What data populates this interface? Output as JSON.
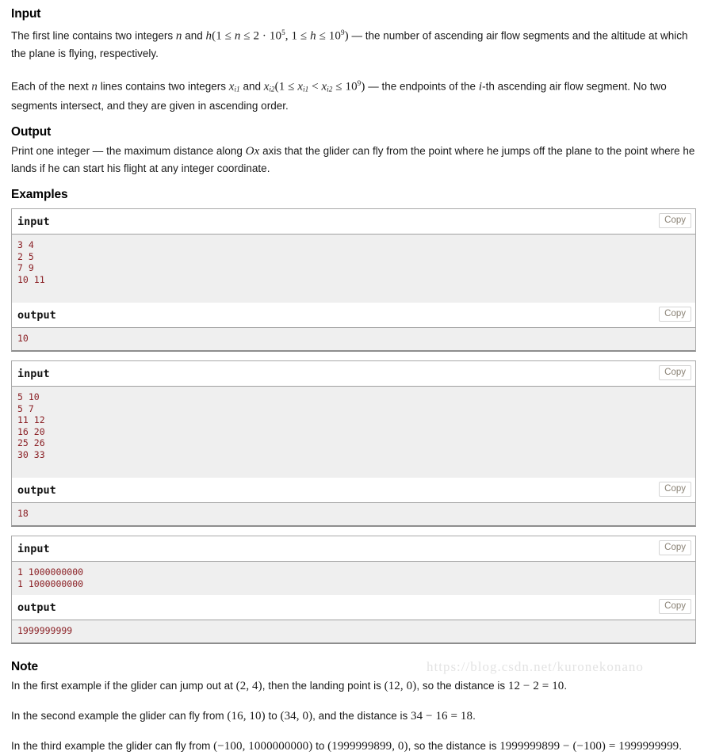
{
  "sections": {
    "input": {
      "heading": "Input",
      "paragraph1": {
        "p1": "The first line contains two integers ",
        "m_n": "n",
        "p2": " and ",
        "m_h": "h",
        "m_cond_open": "(1 ≤ ",
        "m_cond_n": "n",
        "m_cond_mid": " ≤ 2 · 10",
        "m_cond_exp1": "5",
        "m_cond_mid2": ", 1 ≤ ",
        "m_cond_h": "h",
        "m_cond_mid3": " ≤ 10",
        "m_cond_exp2": "9",
        "m_cond_close": ")",
        "p3": " — the number of ascending air flow segments and the altitude at which the plane is flying, respectively."
      },
      "paragraph2": {
        "p1": "Each of the next ",
        "m_n": "n",
        "p2": " lines contains two integers ",
        "m_x1": "x",
        "m_x1sub": "i1",
        "p3": " and ",
        "m_x2": "x",
        "m_x2sub": "i2",
        "m_cond_open": "(1 ≤ ",
        "m_cond_x1": "x",
        "m_cond_x1sub": "i1",
        "m_cond_lt": " < ",
        "m_cond_x2": "x",
        "m_cond_x2sub": "i2",
        "m_cond_mid": " ≤ 10",
        "m_cond_exp": "9",
        "m_cond_close": ")",
        "p4": " — the endpoints of the ",
        "m_i": "i",
        "p5": "-th ascending air flow segment. No two segments intersect, and they are given in ascending order."
      }
    },
    "output": {
      "heading": "Output",
      "paragraph": {
        "p1": "Print one integer — the maximum distance along ",
        "m_Ox": "Ox",
        "p2": " axis that the glider can fly from the point where he jumps off the plane to the point where he lands if he can start his flight at any integer coordinate."
      }
    },
    "examples": {
      "heading": "Examples",
      "input_label": "input",
      "output_label": "output",
      "copy_label": "Copy",
      "tests": [
        {
          "input": "3 4\n2 5\n7 9\n10 11",
          "output": "10"
        },
        {
          "input": "5 10\n5 7\n11 12\n16 20\n25 26\n30 33",
          "output": "18"
        },
        {
          "input": "1 1000000000\n1 1000000000",
          "output": "1999999999"
        }
      ]
    },
    "note": {
      "heading": "Note",
      "paragraph1": {
        "p1": "In the first example if the glider can jump out at ",
        "m_a": "(2, 4)",
        "p2": ", then the landing point is ",
        "m_b": "(12, 0)",
        "p3": ", so the distance is ",
        "m_c": "12 − 2 = 10",
        "p4": "."
      },
      "paragraph2": {
        "p1": "In the second example the glider can fly from ",
        "m_a": "(16, 10)",
        "p2": " to ",
        "m_b": "(34, 0)",
        "p3": ", and the distance is ",
        "m_c": "34 − 16 = 18",
        "p4": "."
      },
      "paragraph3": {
        "p1": "In the third example the glider can fly from ",
        "m_a": "(−100, 1000000000)",
        "p2": " to ",
        "m_b": "(1999999899, 0)",
        "p3": ", so the distance is ",
        "m_c": "1999999899 − (−100) = 1999999999",
        "p4": "."
      }
    }
  },
  "watermark": {
    "text": "https://blog.csdn.net/kuronekonano"
  },
  "colors": {
    "io_text": "#8a1f24",
    "io_background": "#efefef",
    "border": "#a9a9a9",
    "copy_text": "#8a8275"
  }
}
